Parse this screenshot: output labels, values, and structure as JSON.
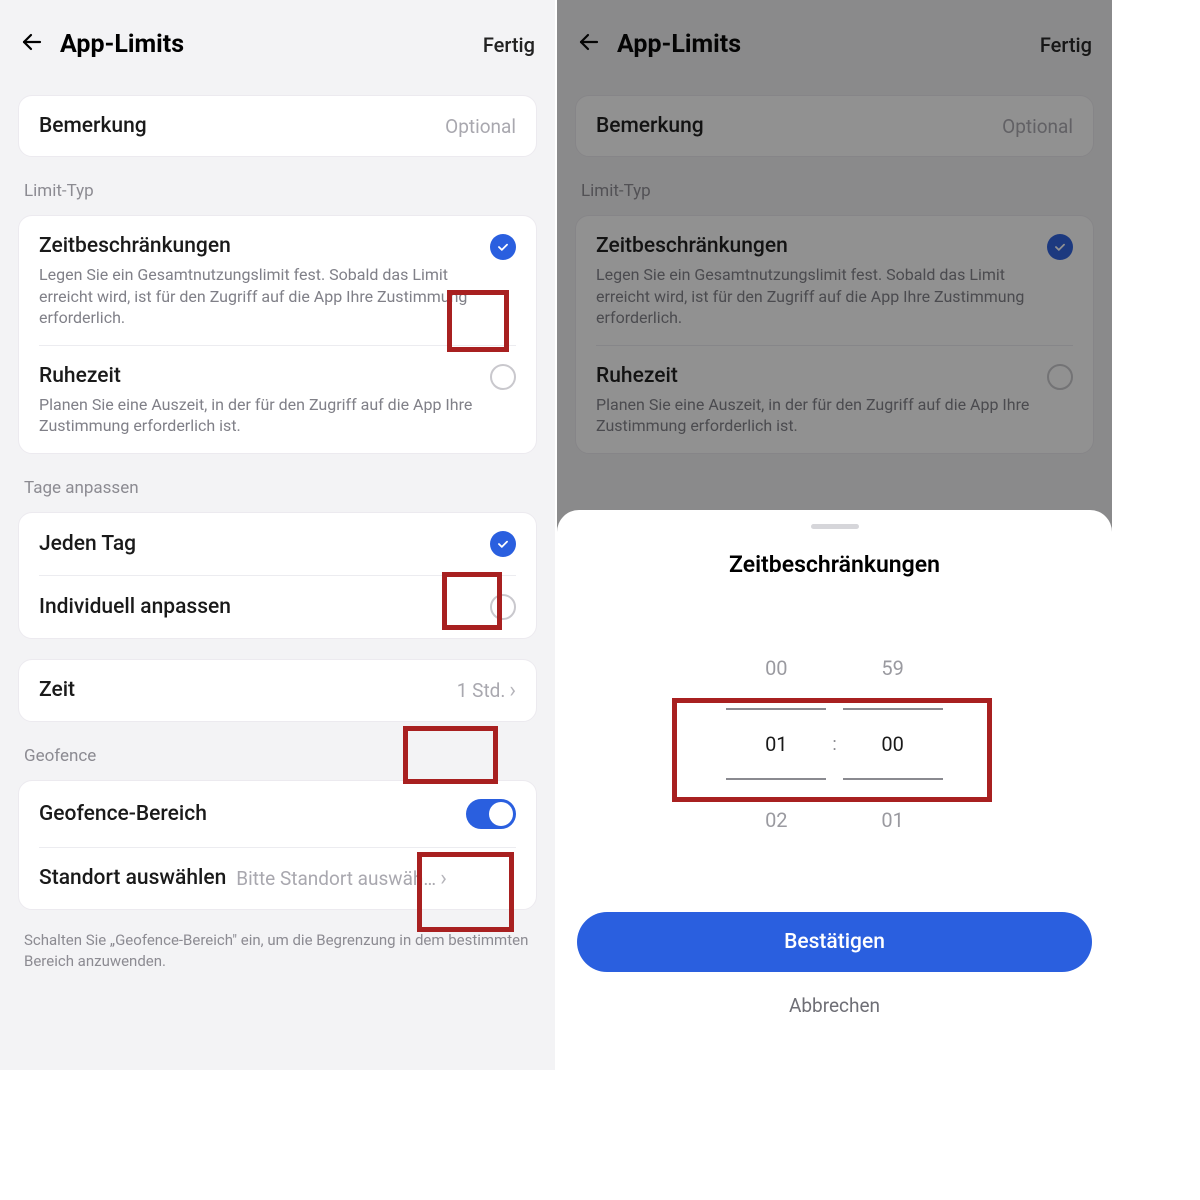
{
  "left": {
    "header": {
      "title": "App-Limits",
      "done": "Fertig"
    },
    "remark": {
      "label": "Bemerkung",
      "placeholder": "Optional"
    },
    "limitType": {
      "section": "Limit-Typ",
      "option1": {
        "title": "Zeitbeschränkungen",
        "desc": "Legen Sie ein Gesamtnutzungslimit fest. Sobald das Limit erreicht wird, ist für den Zugriff auf die App Ihre Zustimmung erforderlich."
      },
      "option2": {
        "title": "Ruhezeit",
        "desc": "Planen Sie eine Auszeit, in der für den Zugriff auf die App Ihre Zustimmung erforderlich ist."
      }
    },
    "days": {
      "section": "Tage anpassen",
      "every": "Jeden Tag",
      "custom": "Individuell anpassen"
    },
    "time": {
      "label": "Zeit",
      "value": "1 Std."
    },
    "geofence": {
      "section": "Geofence",
      "area": "Geofence-Bereich",
      "selectLoc": "Standort auswählen",
      "selectVal": "Bitte Standort auswäh…",
      "hint": "Schalten Sie „Geofence-Bereich\" ein, um die Begrenzung in dem bestimmten Bereich anzuwenden."
    }
  },
  "right": {
    "header": {
      "title": "App-Limits",
      "done": "Fertig"
    },
    "sheet": {
      "title": "Zeitbeschränkungen",
      "hours": {
        "prev": "00",
        "sel": "01",
        "next": "02"
      },
      "mins": {
        "prev": "59",
        "sel": "00",
        "next": "01"
      },
      "confirm": "Bestätigen",
      "cancel": "Abbrechen"
    }
  }
}
